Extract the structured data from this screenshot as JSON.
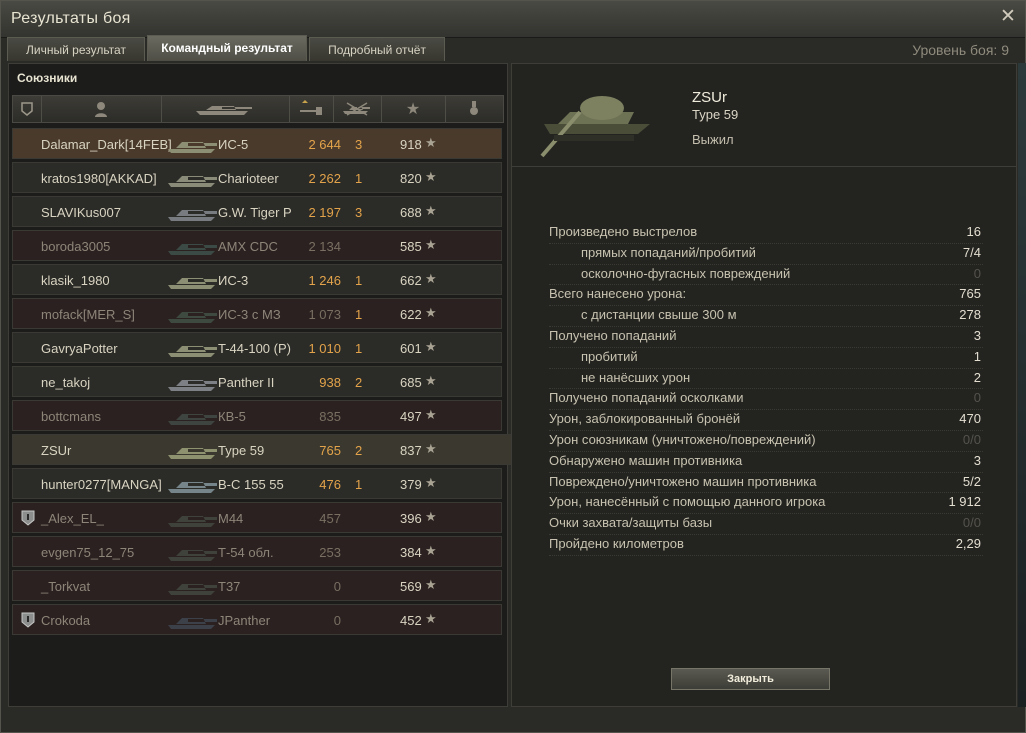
{
  "window": {
    "title": "Результаты боя"
  },
  "tabs": [
    {
      "label": "Личный результат"
    },
    {
      "label": "Командный результат"
    },
    {
      "label": "Подробный отчёт"
    }
  ],
  "battle_level": "Уровень боя: 9",
  "team": {
    "label": "Союзники",
    "rows": [
      {
        "name": "Dalamar_Dark[14FEB]",
        "vehicle": "ИС-5",
        "damage": "2 644",
        "kills": "3",
        "xp": "918"
      },
      {
        "name": "kratos1980[AKKAD]",
        "vehicle": "Charioteer",
        "damage": "2 262",
        "kills": "1",
        "xp": "820"
      },
      {
        "name": "SLAVIKus007",
        "vehicle": "G.W. Tiger P",
        "damage": "2 197",
        "kills": "3",
        "xp": "688"
      },
      {
        "name": "boroda3005",
        "vehicle": "AMX CDC",
        "damage": "2 134",
        "kills": "",
        "xp": "585"
      },
      {
        "name": "klasik_1980",
        "vehicle": "ИС-3",
        "damage": "1 246",
        "kills": "1",
        "xp": "662"
      },
      {
        "name": "mofack[MER_S]",
        "vehicle": "ИС-3 с МЗ",
        "damage": "1 073",
        "kills": "1",
        "xp": "622"
      },
      {
        "name": "GavryaPotter",
        "vehicle": "T-44-100 (P)",
        "damage": "1 010",
        "kills": "1",
        "xp": "601"
      },
      {
        "name": "ne_takoj",
        "vehicle": "Panther II",
        "damage": "938",
        "kills": "2",
        "xp": "685"
      },
      {
        "name": "bottcmans",
        "vehicle": "КВ-5",
        "damage": "835",
        "kills": "",
        "xp": "497"
      },
      {
        "name": "ZSUr",
        "vehicle": "Type 59",
        "damage": "765",
        "kills": "2",
        "xp": "837"
      },
      {
        "name": "hunter0277[MANGA]",
        "vehicle": "В-С 155 55",
        "damage": "476",
        "kills": "1",
        "xp": "379"
      },
      {
        "name": "_Alex_EL_",
        "vehicle": "M44",
        "damage": "457",
        "kills": "",
        "xp": "396"
      },
      {
        "name": "evgen75_12_75",
        "vehicle": "Т-54 обл.",
        "damage": "253",
        "kills": "",
        "xp": "384"
      },
      {
        "name": "_Torkvat",
        "vehicle": "T37",
        "damage": "0",
        "kills": "",
        "xp": "569"
      },
      {
        "name": "Crokoda",
        "vehicle": "JPanther",
        "damage": "0",
        "kills": "",
        "xp": "452"
      }
    ]
  },
  "details": {
    "player": "ZSUr",
    "tank": "Type 59",
    "status": "Выжил",
    "stats": [
      {
        "label": "Произведено выстрелов",
        "value": "16"
      },
      {
        "label": "прямых попаданий/пробитий",
        "value": "7/4"
      },
      {
        "label": "осколочно-фугасных повреждений",
        "value": "0"
      },
      {
        "label": "Всего нанесено урона:",
        "value": "765"
      },
      {
        "label": "с дистанции свыше 300 м",
        "value": "278"
      },
      {
        "label": "Получено попаданий",
        "value": "3"
      },
      {
        "label": "пробитий",
        "value": "1"
      },
      {
        "label": "не нанёсших урон",
        "value": "2"
      },
      {
        "label": "Получено попаданий осколками",
        "value": "0"
      },
      {
        "label": "Урон, заблокированный бронёй",
        "value": "470"
      },
      {
        "label": "Урон союзникам (уничтожено/повреждений)",
        "value": "0/0"
      },
      {
        "label": "Обнаружено машин противника",
        "value": "3"
      },
      {
        "label": "Повреждено/уничтожено машин противника",
        "value": "5/2"
      },
      {
        "label": "Урон, нанесённый с помощью данного игрока",
        "value": "1 912"
      },
      {
        "label": "Очки захвата/защиты базы",
        "value": "0/0"
      },
      {
        "label": "Пройдено километров",
        "value": "2,29"
      }
    ],
    "close_label": "Закрыть"
  }
}
